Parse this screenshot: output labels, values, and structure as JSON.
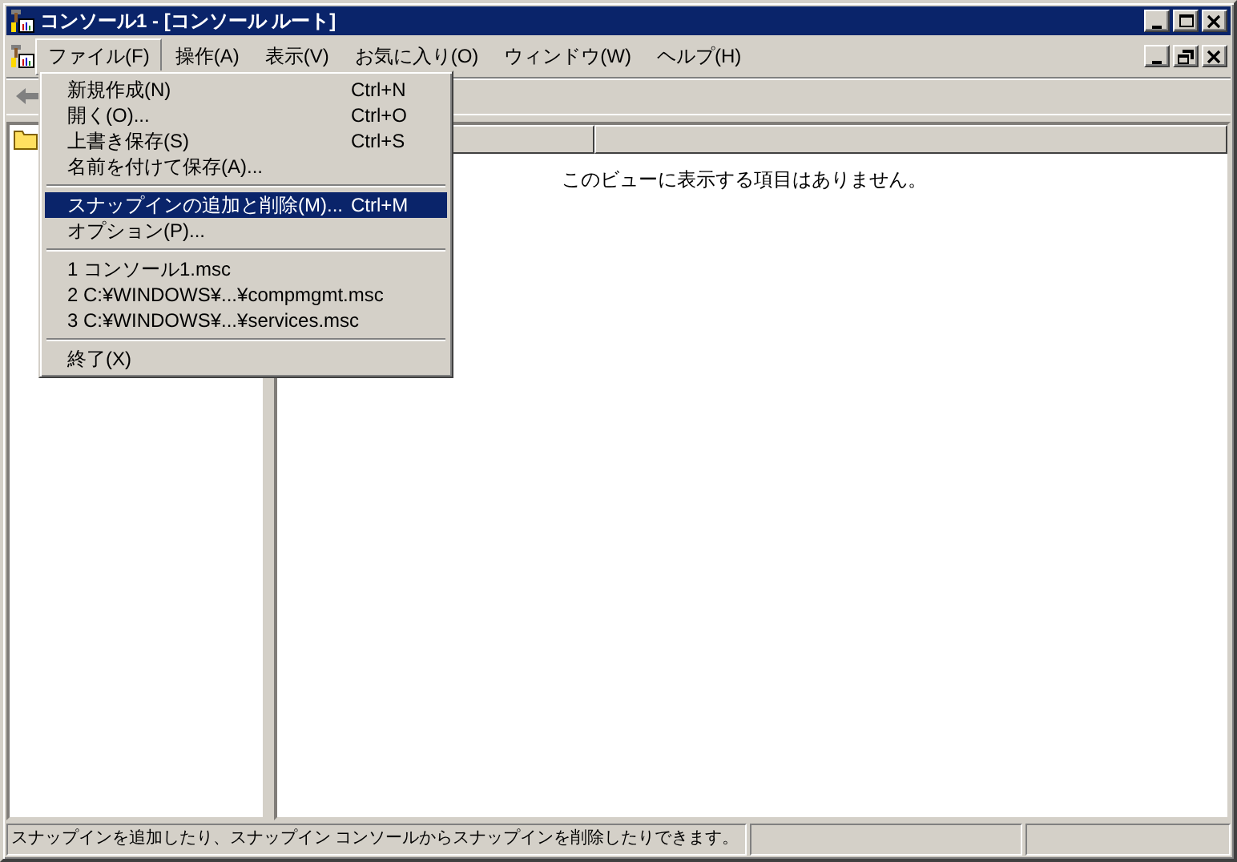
{
  "window": {
    "title": "コンソール1 - [コンソール ルート]"
  },
  "menu_bar": [
    {
      "label": "ファイル(F)",
      "selected": true
    },
    {
      "label": "操作(A)",
      "selected": false
    },
    {
      "label": "表示(V)",
      "selected": false
    },
    {
      "label": "お気に入り(O)",
      "selected": false
    },
    {
      "label": "ウィンドウ(W)",
      "selected": false
    },
    {
      "label": "ヘルプ(H)",
      "selected": false
    }
  ],
  "file_menu": [
    {
      "kind": "item",
      "label": "新規作成(N)",
      "shortcut": "Ctrl+N",
      "selected": false
    },
    {
      "kind": "item",
      "label": "開く(O)...",
      "shortcut": "Ctrl+O",
      "selected": false
    },
    {
      "kind": "item",
      "label": "上書き保存(S)",
      "shortcut": "Ctrl+S",
      "selected": false
    },
    {
      "kind": "item",
      "label": "名前を付けて保存(A)...",
      "selected": false
    },
    {
      "kind": "separator"
    },
    {
      "kind": "item",
      "label": "スナップインの追加と削除(M)...",
      "shortcut": "Ctrl+M",
      "selected": true
    },
    {
      "kind": "item",
      "label": "オプション(P)...",
      "selected": false
    },
    {
      "kind": "separator"
    },
    {
      "kind": "item",
      "label": "1 コンソール1.msc",
      "selected": false
    },
    {
      "kind": "item",
      "label": "2 C:¥WINDOWS¥...¥compmgmt.msc",
      "selected": false
    },
    {
      "kind": "item",
      "label": "3 C:¥WINDOWS¥...¥services.msc",
      "selected": false
    },
    {
      "kind": "separator"
    },
    {
      "kind": "item",
      "label": "終了(X)",
      "selected": false
    }
  ],
  "result_pane": {
    "empty_message": "このビューに表示する項目はありません。"
  },
  "status_bar": {
    "text": "スナップインを追加したり、スナップイン コンソールからスナップインを削除したりできます。"
  }
}
